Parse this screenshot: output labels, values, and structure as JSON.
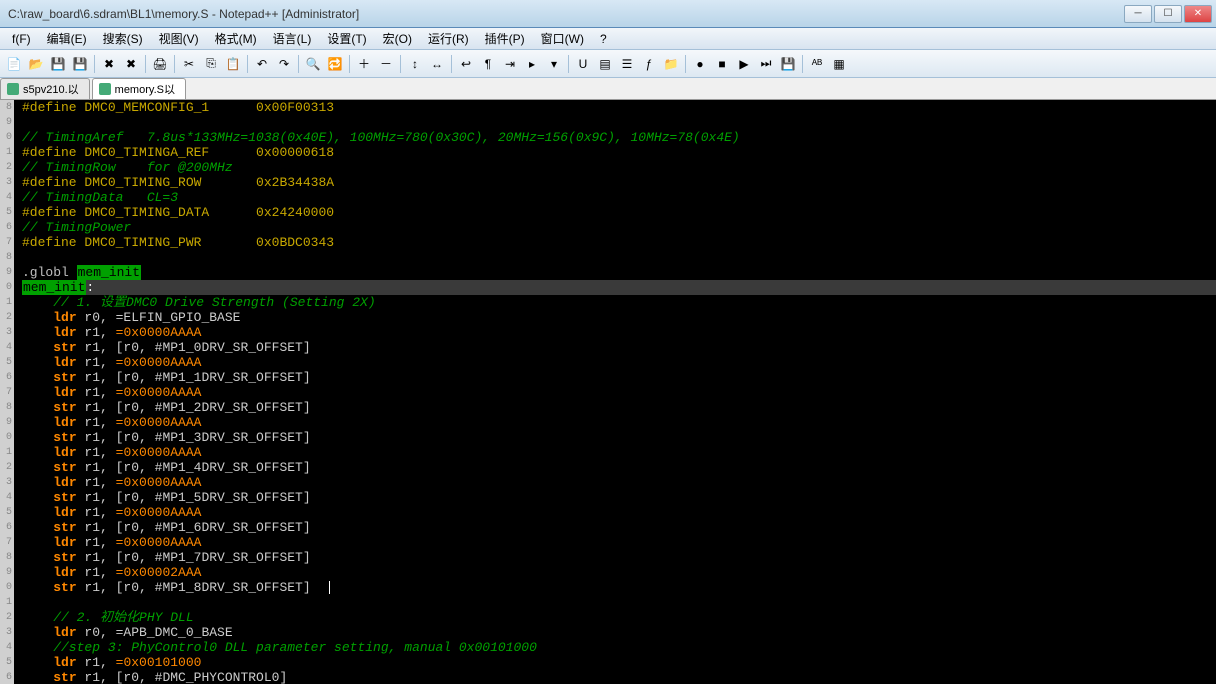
{
  "title": "C:\\raw_board\\6.sdram\\BL1\\memory.S - Notepad++ [Administrator]",
  "menus": [
    "f(F)",
    "编辑(E)",
    "搜索(S)",
    "视图(V)",
    "格式(M)",
    "语言(L)",
    "设置(T)",
    "宏(O)",
    "运行(R)",
    "插件(P)",
    "窗口(W)",
    "?"
  ],
  "tabs": [
    {
      "label": "s5pv210.以",
      "active": false
    },
    {
      "label": "memory.S以",
      "active": true
    }
  ],
  "lines": [
    {
      "n": "8",
      "type": "define",
      "parts": [
        "#define DMC0_MEMCONFIG_1      0x00F00313"
      ]
    },
    {
      "n": "9",
      "type": "blank",
      "parts": [
        ""
      ]
    },
    {
      "n": "0",
      "type": "comment",
      "parts": [
        "// TimingAref   7.8us*133MHz=1038(0x40E), 100MHz=780(0x30C), 20MHz=156(0x9C), 10MHz=78(0x4E)"
      ]
    },
    {
      "n": "1",
      "type": "define",
      "parts": [
        "#define DMC0_TIMINGA_REF      0x00000618"
      ]
    },
    {
      "n": "2",
      "type": "comment",
      "parts": [
        "// TimingRow    for @200MHz"
      ]
    },
    {
      "n": "3",
      "type": "define",
      "parts": [
        "#define DMC0_TIMING_ROW       0x2B34438A"
      ]
    },
    {
      "n": "4",
      "type": "comment",
      "parts": [
        "// TimingData   CL=3"
      ]
    },
    {
      "n": "5",
      "type": "define",
      "parts": [
        "#define DMC0_TIMING_DATA      0x24240000"
      ]
    },
    {
      "n": "6",
      "type": "comment",
      "parts": [
        "// TimingPower"
      ]
    },
    {
      "n": "7",
      "type": "define",
      "parts": [
        "#define DMC0_TIMING_PWR       0x0BDC0343"
      ]
    },
    {
      "n": "8",
      "type": "blank",
      "parts": [
        ""
      ]
    },
    {
      "n": "9",
      "type": "globl",
      "parts": [
        ".globl ",
        "mem_init"
      ]
    },
    {
      "n": "0",
      "type": "labelhl",
      "parts": [
        "mem_init",
        ":"
      ]
    },
    {
      "n": "1",
      "type": "comment",
      "parts": [
        "    // 1. 设置DMC0 Drive Strength (Setting 2X)"
      ]
    },
    {
      "n": "2",
      "type": "ldr",
      "parts": [
        "    ",
        "ldr",
        " r0, =ELFIN_GPIO_BASE"
      ]
    },
    {
      "n": "3",
      "type": "ldrnum",
      "parts": [
        "    ",
        "ldr",
        " r1, ",
        "=0x0000AAAA"
      ]
    },
    {
      "n": "4",
      "type": "str",
      "parts": [
        "    ",
        "str",
        " r1, [r0, #MP1_0DRV_SR_OFFSET]"
      ]
    },
    {
      "n": "5",
      "type": "ldrnum",
      "parts": [
        "    ",
        "ldr",
        " r1, ",
        "=0x0000AAAA"
      ]
    },
    {
      "n": "6",
      "type": "str",
      "parts": [
        "    ",
        "str",
        " r1, [r0, #MP1_1DRV_SR_OFFSET]"
      ]
    },
    {
      "n": "7",
      "type": "ldrnum",
      "parts": [
        "    ",
        "ldr",
        " r1, ",
        "=0x0000AAAA"
      ]
    },
    {
      "n": "8",
      "type": "str",
      "parts": [
        "    ",
        "str",
        " r1, [r0, #MP1_2DRV_SR_OFFSET]"
      ]
    },
    {
      "n": "9",
      "type": "ldrnum",
      "parts": [
        "    ",
        "ldr",
        " r1, ",
        "=0x0000AAAA"
      ]
    },
    {
      "n": "0",
      "type": "str",
      "parts": [
        "    ",
        "str",
        " r1, [r0, #MP1_3DRV_SR_OFFSET]"
      ]
    },
    {
      "n": "1",
      "type": "ldrnum",
      "parts": [
        "    ",
        "ldr",
        " r1, ",
        "=0x0000AAAA"
      ]
    },
    {
      "n": "2",
      "type": "str",
      "parts": [
        "    ",
        "str",
        " r1, [r0, #MP1_4DRV_SR_OFFSET]"
      ]
    },
    {
      "n": "3",
      "type": "ldrnum",
      "parts": [
        "    ",
        "ldr",
        " r1, ",
        "=0x0000AAAA"
      ]
    },
    {
      "n": "4",
      "type": "str",
      "parts": [
        "    ",
        "str",
        " r1, [r0, #MP1_5DRV_SR_OFFSET]"
      ]
    },
    {
      "n": "5",
      "type": "ldrnum",
      "parts": [
        "    ",
        "ldr",
        " r1, ",
        "=0x0000AAAA"
      ]
    },
    {
      "n": "6",
      "type": "str",
      "parts": [
        "    ",
        "str",
        " r1, [r0, #MP1_6DRV_SR_OFFSET]"
      ]
    },
    {
      "n": "7",
      "type": "ldrnum",
      "parts": [
        "    ",
        "ldr",
        " r1, ",
        "=0x0000AAAA"
      ]
    },
    {
      "n": "8",
      "type": "str",
      "parts": [
        "    ",
        "str",
        " r1, [r0, #MP1_7DRV_SR_OFFSET]"
      ]
    },
    {
      "n": "9",
      "type": "ldrnum",
      "parts": [
        "    ",
        "ldr",
        " r1, ",
        "=0x00002AAA"
      ]
    },
    {
      "n": "0",
      "type": "strcursor",
      "parts": [
        "    ",
        "str",
        " r1, [r0, #MP1_8DRV_SR_OFFSET]"
      ]
    },
    {
      "n": "1",
      "type": "blank",
      "parts": [
        ""
      ]
    },
    {
      "n": "2",
      "type": "comment",
      "parts": [
        "    // 2. 初始化PHY DLL"
      ]
    },
    {
      "n": "3",
      "type": "ldr",
      "parts": [
        "    ",
        "ldr",
        " r0, =APB_DMC_0_BASE"
      ]
    },
    {
      "n": "4",
      "type": "comment",
      "parts": [
        "    //step 3: PhyControl0 DLL parameter setting, manual 0x00101000"
      ]
    },
    {
      "n": "5",
      "type": "ldrnum",
      "parts": [
        "    ",
        "ldr",
        " r1, ",
        "=0x00101000"
      ]
    },
    {
      "n": "6",
      "type": "str",
      "parts": [
        "    ",
        "str",
        " r1, [r0, #DMC_PHYCONTROL0]"
      ]
    }
  ],
  "toolbar_icons": [
    "new-file-icon",
    "open-file-icon",
    "save-icon",
    "save-all-icon",
    "sep",
    "close-icon",
    "close-all-icon",
    "sep",
    "print-icon",
    "sep",
    "cut-icon",
    "copy-icon",
    "paste-icon",
    "sep",
    "undo-icon",
    "redo-icon",
    "sep",
    "find-icon",
    "replace-icon",
    "sep",
    "zoom-in-icon",
    "zoom-out-icon",
    "sep",
    "sync-v-icon",
    "sync-h-icon",
    "sep",
    "wordwrap-icon",
    "show-all-icon",
    "indent-icon",
    "fold-icon",
    "unfold-icon",
    "sep",
    "udl-icon",
    "doc-map-icon",
    "doc-list-icon",
    "func-list-icon",
    "folder-icon",
    "sep",
    "rec-macro-icon",
    "stop-macro-icon",
    "play-macro-icon",
    "play-multi-icon",
    "save-macro-icon",
    "sep",
    "spellcheck-icon",
    "toggle-icon"
  ]
}
